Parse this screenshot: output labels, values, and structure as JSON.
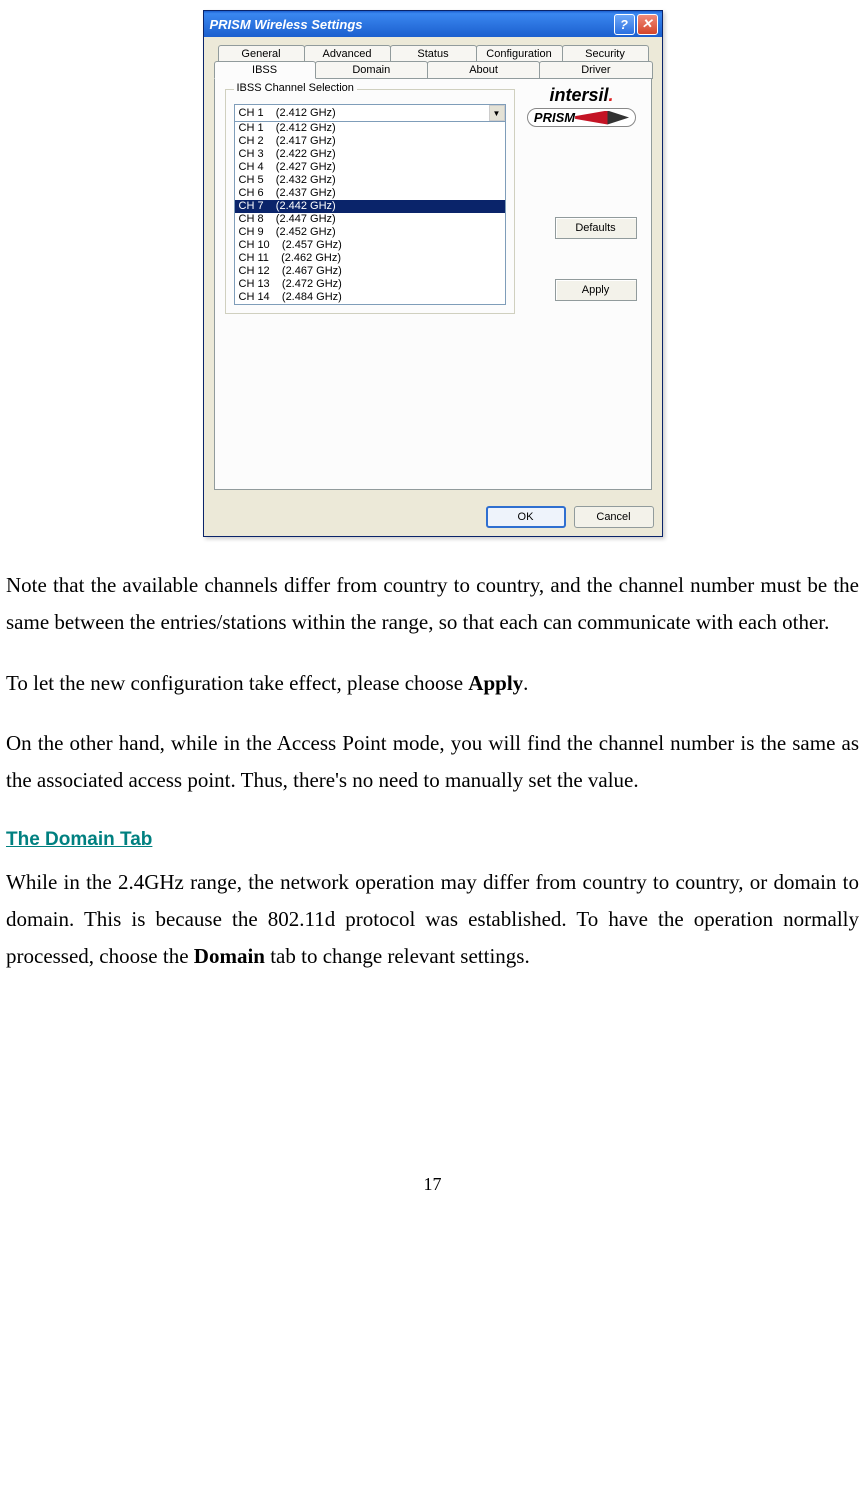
{
  "dialog": {
    "title": "PRISM Wireless Settings",
    "tabs_row1": [
      "General",
      "Advanced",
      "Status",
      "Configuration",
      "Security"
    ],
    "tabs_row2": [
      "IBSS",
      "Domain",
      "About",
      "Driver"
    ],
    "active_tab": "IBSS",
    "groupbox_label": "IBSS Channel Selection",
    "combo_selected": "CH 1    (2.412 GHz)",
    "channels": [
      "CH 1    (2.412 GHz)",
      "CH 2    (2.417 GHz)",
      "CH 3    (2.422 GHz)",
      "CH 4    (2.427 GHz)",
      "CH 5    (2.432 GHz)",
      "CH 6    (2.437 GHz)",
      "CH 7    (2.442 GHz)",
      "CH 8    (2.447 GHz)",
      "CH 9    (2.452 GHz)",
      "CH 10    (2.457 GHz)",
      "CH 11    (2.462 GHz)",
      "CH 12    (2.467 GHz)",
      "CH 13    (2.472 GHz)",
      "CH 14    (2.484 GHz)"
    ],
    "selected_channel_index": 6,
    "brand_top": "intersil",
    "brand_bottom": "PRISM",
    "defaults_label": "Defaults",
    "apply_label": "Apply",
    "ok_label": "OK",
    "cancel_label": "Cancel"
  },
  "doc": {
    "p1": "Note that the available channels differ from country to country, and the channel number must be the same between the entries/stations within the range, so that each can communicate with each other.",
    "p2_a": "To let the new configuration take effect, please choose ",
    "p2_b": "Apply",
    "p2_c": ".",
    "p3": "On the other hand, while in the Access Point mode, you will find the channel number is the same as the associated access point. Thus, there's no need to manually set the value.",
    "heading": "The Domain Tab",
    "p4_a": "While in the 2.4GHz range, the network operation may differ from country to country, or domain to domain. This is because the 802.11d protocol was established. To have the operation normally processed, choose the ",
    "p4_b": "Domain",
    "p4_c": " tab to change relevant settings.",
    "page_number": "17"
  }
}
